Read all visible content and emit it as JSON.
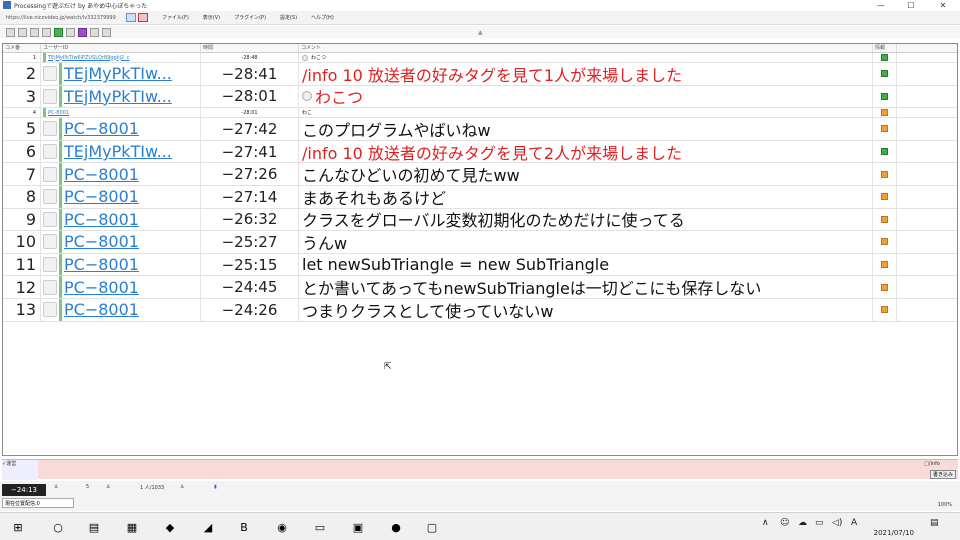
{
  "window": {
    "title": "Processingで遊ぶだけ by あやめ中心ぽちゃった",
    "minimize": "—",
    "maximize": "☐",
    "close": "✕"
  },
  "menubar": {
    "url": "https://live.nicovideo.jp/watch/lv332379999",
    "items": [
      "ファイル(F)",
      "表示(V)",
      "プラグイン(P)",
      "設定(S)",
      "ヘルプ(H)"
    ]
  },
  "grid": {
    "headers": [
      "コメ番",
      "ユーザーID",
      "時間",
      "コメント",
      "情報"
    ],
    "rows": [
      {
        "no": "1",
        "user": "TEjMyPkTIw6lPZUSLQr89ggkj2_c",
        "time": "-28:48",
        "comment": "わこつ",
        "red": false,
        "size": "tiny",
        "info": "green",
        "circle": true
      },
      {
        "no": "2",
        "user": "TEjMyPkTIw...",
        "time": "−28:41",
        "comment": "/info 10 放送者の好みタグを見て1人が来場しました",
        "red": true,
        "size": "big",
        "info": "green",
        "circle": false
      },
      {
        "no": "3",
        "user": "TEjMyPkTIw...",
        "time": "−28:01",
        "comment": "わこつ",
        "red": true,
        "size": "big",
        "info": "green",
        "circle": true
      },
      {
        "no": "4",
        "user": "PC-8001",
        "time": "-28:01",
        "comment": "わこ",
        "red": false,
        "size": "tiny",
        "info": "orange",
        "circle": false
      },
      {
        "no": "5",
        "user": "PC−8001",
        "time": "−27:42",
        "comment": "このプログラムやばいねw",
        "red": false,
        "size": "big",
        "info": "orange",
        "circle": false
      },
      {
        "no": "6",
        "user": "TEjMyPkTIw...",
        "time": "−27:41",
        "comment": "/info 10 放送者の好みタグを見て2人が来場しました",
        "red": true,
        "size": "big",
        "info": "green",
        "circle": false
      },
      {
        "no": "7",
        "user": "PC−8001",
        "time": "−27:26",
        "comment": "こんなひどいの初めて見たww",
        "red": false,
        "size": "big",
        "info": "orange",
        "circle": false
      },
      {
        "no": "8",
        "user": "PC−8001",
        "time": "−27:14",
        "comment": "まあそれもあるけど",
        "red": false,
        "size": "big",
        "info": "orange",
        "circle": false
      },
      {
        "no": "9",
        "user": "PC−8001",
        "time": "−26:32",
        "comment": "クラスをグローバル変数初期化のためだけに使ってる",
        "red": false,
        "size": "big",
        "info": "orange",
        "circle": false
      },
      {
        "no": "10",
        "user": "PC−8001",
        "time": "−25:27",
        "comment": "うんw",
        "red": false,
        "size": "big",
        "info": "orange",
        "circle": false
      },
      {
        "no": "11",
        "user": "PC−8001",
        "time": "−25:15",
        "comment": "let newSubTriangle = new SubTriangle",
        "red": false,
        "size": "big",
        "info": "orange",
        "circle": false
      },
      {
        "no": "12",
        "user": "PC−8001",
        "time": "−24:45",
        "comment": "とか書いてあってもnewSubTriangleは一切どこにも保存しない",
        "red": false,
        "size": "big",
        "info": "orange",
        "circle": false
      },
      {
        "no": "13",
        "user": "PC−8001",
        "time": "−24:26",
        "comment": "つまりクラスとして使っていないw",
        "red": false,
        "size": "big",
        "info": "orange",
        "circle": false
      }
    ]
  },
  "inputbar": {
    "left_label": "✓運営",
    "checkbox": "□/info",
    "send": "書き込み"
  },
  "statusbar": {
    "time": "−24:13",
    "mode": "現在位置配信:0",
    "stat1": "1 人/1033",
    "stat2": "5",
    "zoom": "100%"
  },
  "taskbar": {
    "clock_date": "2021/07/10",
    "ime": "A"
  },
  "colors": {
    "accent_link": "#2a7fd4",
    "alert_red": "#e02020",
    "input_bg": "#f8dada"
  }
}
